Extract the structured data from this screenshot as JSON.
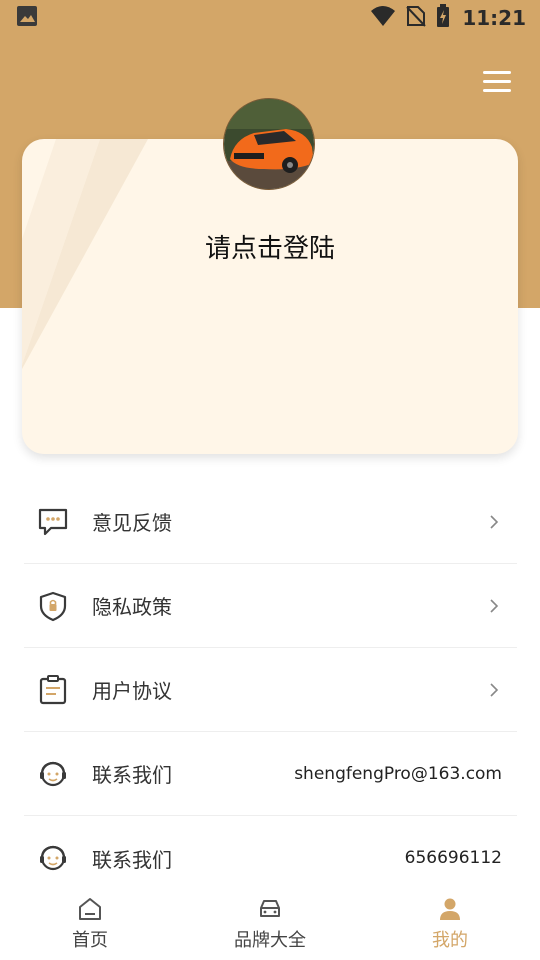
{
  "status_bar": {
    "time": "11:21"
  },
  "profile": {
    "login_prompt": "请点击登陆"
  },
  "menu": [
    {
      "icon": "feedback-icon",
      "label": "意见反馈",
      "value": ""
    },
    {
      "icon": "privacy-shield-icon",
      "label": "隐私政策",
      "value": ""
    },
    {
      "icon": "agreement-icon",
      "label": "用户协议",
      "value": ""
    },
    {
      "icon": "customer-service-icon",
      "label": "联系我们",
      "value": "shengfengPro@163.com"
    },
    {
      "icon": "customer-service-icon",
      "label": "联系我们",
      "value": "656696112"
    }
  ],
  "tabs": [
    {
      "icon": "home-icon",
      "label": "首页",
      "active": false
    },
    {
      "icon": "car-icon",
      "label": "品牌大全",
      "active": false
    },
    {
      "icon": "user-icon",
      "label": "我的",
      "active": true
    }
  ],
  "colors": {
    "accent": "#D3A668",
    "card_bg": "#FFF6E8"
  }
}
